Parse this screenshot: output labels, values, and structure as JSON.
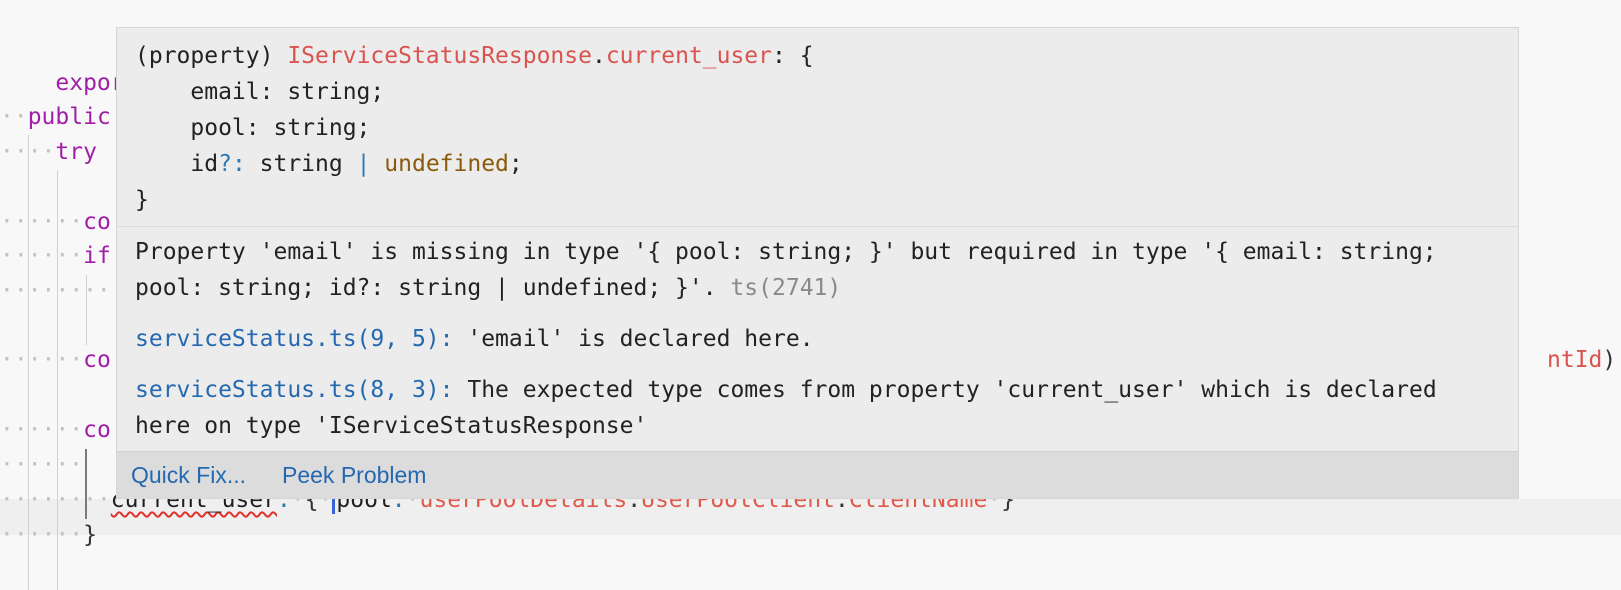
{
  "editor": {
    "lines": [
      {
        "text": "export d"
      },
      {
        "text": "public"
      },
      {
        "text": "try"
      },
      {
        "text": "co"
      },
      {
        "text": "if"
      },
      {
        "text": "co"
      },
      {
        "text": "co"
      }
    ],
    "right_fragment": "ntId",
    "right_paren": ")",
    "current_line": {
      "prop": "current_user",
      "colon": ":",
      "open_brace": "{",
      "key": "pool",
      "key_colon": ":",
      "v1": "userPoolDetails",
      "dot1": ".",
      "v2": "UserPoolClient",
      "dot2": ".",
      "v3": "ClientName",
      "close_brace": "}"
    },
    "closing_brace": "}"
  },
  "hover": {
    "signature": {
      "prefix": "(property) ",
      "interface": "IServiceStatusResponse",
      "dot": ".",
      "property": "current_user",
      "colon_open": ": {",
      "email_key": "    email",
      "email_type": ": string;",
      "pool_line": "    pool: string;",
      "id_key": "    id",
      "id_opt": "?:",
      "id_type": " string ",
      "id_pipe": "|",
      "id_undef": " undefined",
      "id_semi": ";",
      "close": "}"
    },
    "error_message": "Property 'email' is missing in type '{ pool: string; }' but required in type '{ email: string; pool: string; id?: string | undefined; }'.",
    "error_code": "ts(2741)",
    "related": [
      {
        "location": "serviceStatus.ts(9, 5):",
        "message": "'email' is declared here."
      },
      {
        "location": "serviceStatus.ts(8, 3):",
        "message": "The expected type comes from property 'current_user' which is declared here on type 'IServiceStatusResponse'"
      }
    ],
    "actions": {
      "quick_fix": "Quick Fix...",
      "peek_problem": "Peek Problem"
    }
  }
}
